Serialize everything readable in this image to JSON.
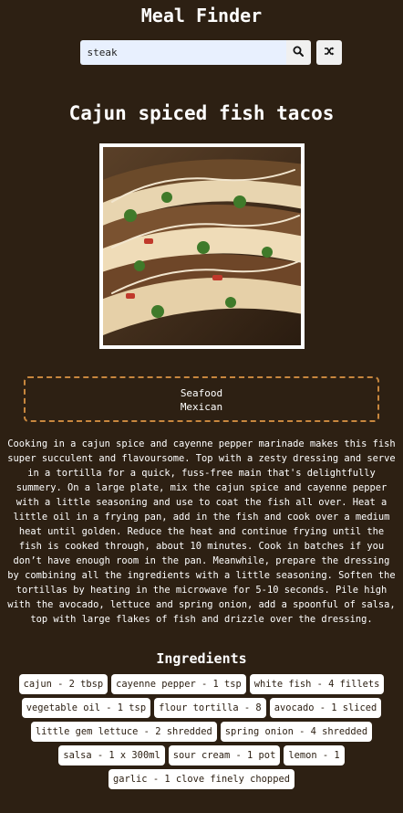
{
  "header": {
    "title": "Meal Finder"
  },
  "search": {
    "value": "steak",
    "search_icon": "search-icon",
    "random_icon": "shuffle-icon"
  },
  "meal": {
    "title": "Cajun spiced fish tacos",
    "category": "Seafood",
    "area": "Mexican",
    "instructions": "Cooking in a cajun spice and cayenne pepper marinade makes this fish super succulent and flavoursome. Top with a zesty dressing and serve in a tortilla for a quick, fuss-free main that's delightfully summery. On a large plate, mix the cajun spice and cayenne pepper with a little seasoning and use to coat the fish all over. Heat a little oil in a frying pan, add in the fish and cook over a medium heat until golden. Reduce the heat and continue frying until the fish is cooked through, about 10 minutes. Cook in batches if you don’t have enough room in the pan. Meanwhile, prepare the dressing by combining all the ingredients with a little seasoning. Soften the tortillas by heating in the microwave for 5-10 seconds. Pile high with the avocado, lettuce and spring onion, add a spoonful of salsa, top with large flakes of fish and drizzle over the dressing."
  },
  "ingredients": {
    "heading": "Ingredients",
    "items": [
      "cajun - 2 tbsp",
      "cayenne pepper - 1 tsp",
      "white fish - 4 fillets",
      "vegetable oil - 1 tsp",
      "flour tortilla - 8",
      "avocado - 1 sliced",
      "little gem lettuce - 2 shredded",
      "spring onion - 4 shredded",
      "salsa - 1 x 300ml",
      "sour cream - 1 pot",
      "lemon - 1",
      "garlic - 1 clove finely chopped"
    ]
  },
  "colors": {
    "background": "#2d2013",
    "accent_border": "#c8873e",
    "chip_bg": "#ffffff",
    "input_bg": "#e8f0fe"
  }
}
